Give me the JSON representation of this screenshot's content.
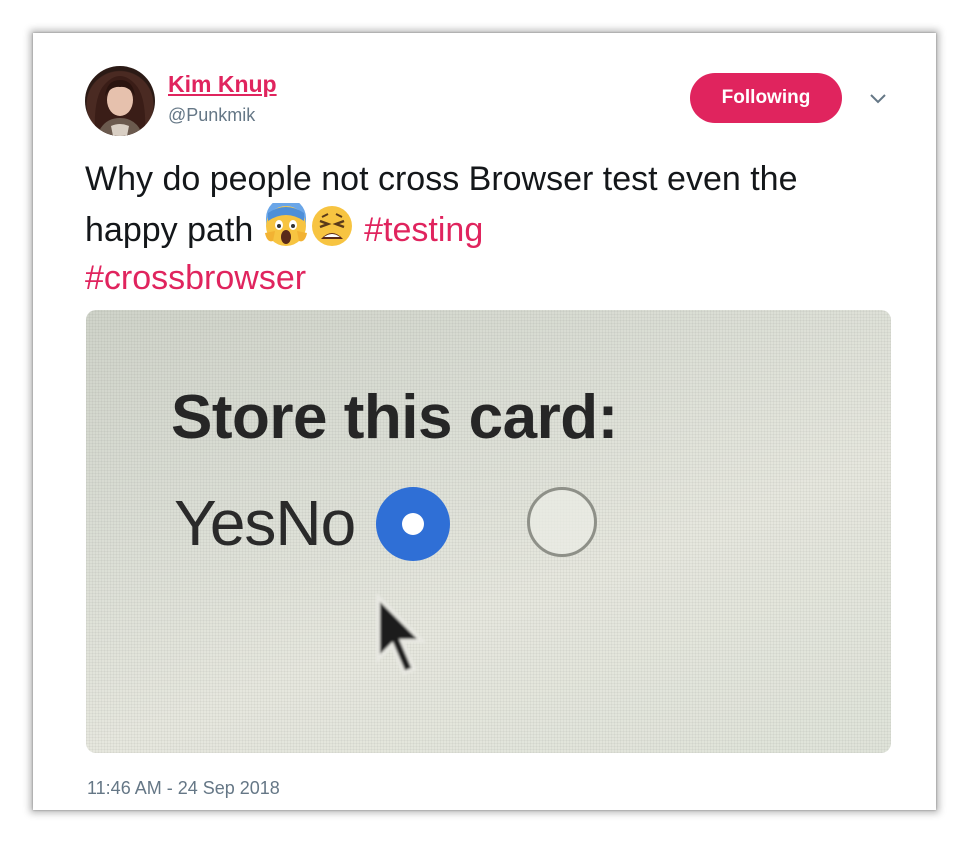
{
  "user": {
    "name": "Kim Knup",
    "handle": "@Punkmik"
  },
  "follow_button": {
    "label": "Following"
  },
  "tweet": {
    "text_main": "Why do people not cross Browser test even the happy path",
    "emojis": [
      "face-screaming-in-fear-icon",
      "weary-face-icon"
    ],
    "hashtags": [
      "#testing",
      "#crossbrowser"
    ],
    "timestamp": "11:46 AM - 24 Sep 2018"
  },
  "media": {
    "heading": "Store this card:",
    "options_text": "YesNo",
    "selected_option": "first"
  },
  "colors": {
    "accent": "#e0245e",
    "text": "#14171a",
    "secondary": "#657786",
    "radio_blue": "#2f6fd6"
  }
}
